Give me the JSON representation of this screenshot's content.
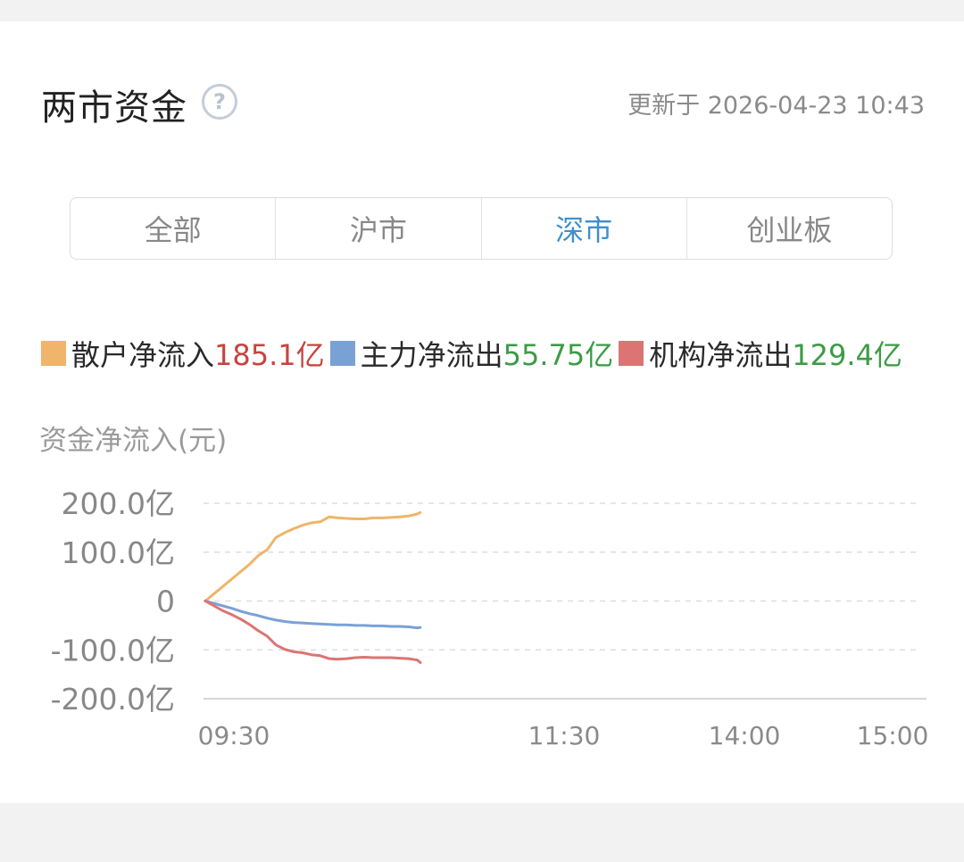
{
  "header": {
    "title": "两市资金",
    "help_icon_glyph": "?",
    "updated": "更新于 2026-04-23 10:43"
  },
  "tabs": [
    {
      "label": "全部",
      "active": false
    },
    {
      "label": "沪市",
      "active": false
    },
    {
      "label": "深市",
      "active": true
    },
    {
      "label": "创业板",
      "active": false
    }
  ],
  "legend": [
    {
      "name": "散户净流入",
      "value": "185.1亿",
      "swatch": "#f0b46a",
      "value_color": "up"
    },
    {
      "name": "主力净流出",
      "value": "55.75亿",
      "swatch": "#7aa1d6",
      "value_color": "down"
    },
    {
      "name": "机构净流出",
      "value": "129.4亿",
      "swatch": "#dc7474",
      "value_color": "down"
    }
  ],
  "colors": {
    "accent": "#3f8fca",
    "up": "#c7443f",
    "down": "#3d9b46",
    "grid": "#dddddd"
  },
  "chart_data": {
    "type": "line",
    "ylabel": "资金净流入(元)",
    "yticks": [
      200,
      100,
      0,
      -100,
      -200
    ],
    "ytick_labels": [
      "200.0亿",
      "100.0亿",
      "0",
      "-100.0亿",
      "-200.0亿"
    ],
    "ylim": [
      -200,
      200
    ],
    "xticks": [
      "09:30",
      "11:30",
      "14:00",
      "15:00"
    ],
    "x_minutes": [
      0,
      3,
      6,
      9,
      12,
      15,
      18,
      21,
      24,
      27,
      30,
      33,
      36,
      39,
      42,
      45,
      48,
      51,
      54,
      57,
      60,
      63,
      66,
      69,
      72,
      73
    ],
    "series": [
      {
        "name": "散户净流入",
        "color": "#f0b46a",
        "values": [
          0,
          15,
          30,
          45,
          60,
          75,
          93,
          105,
          130,
          140,
          148,
          155,
          160,
          162,
          172,
          170,
          169,
          168,
          168,
          170,
          170,
          171,
          172,
          174,
          178,
          181
        ]
      },
      {
        "name": "主力净流出",
        "color": "#7aa1d6",
        "values": [
          0,
          -5,
          -10,
          -15,
          -21,
          -26,
          -30,
          -35,
          -39,
          -42,
          -44,
          -45,
          -46,
          -47,
          -48,
          -49,
          -49,
          -50,
          -50,
          -51,
          -51,
          -52,
          -52,
          -53,
          -55,
          -54
        ]
      },
      {
        "name": "机构净流出",
        "color": "#dc7474",
        "values": [
          0,
          -10,
          -20,
          -28,
          -37,
          -48,
          -61,
          -72,
          -90,
          -99,
          -104,
          -106,
          -110,
          -112,
          -118,
          -119,
          -118,
          -116,
          -115,
          -116,
          -116,
          -116,
          -117,
          -118,
          -121,
          -126
        ]
      }
    ]
  }
}
